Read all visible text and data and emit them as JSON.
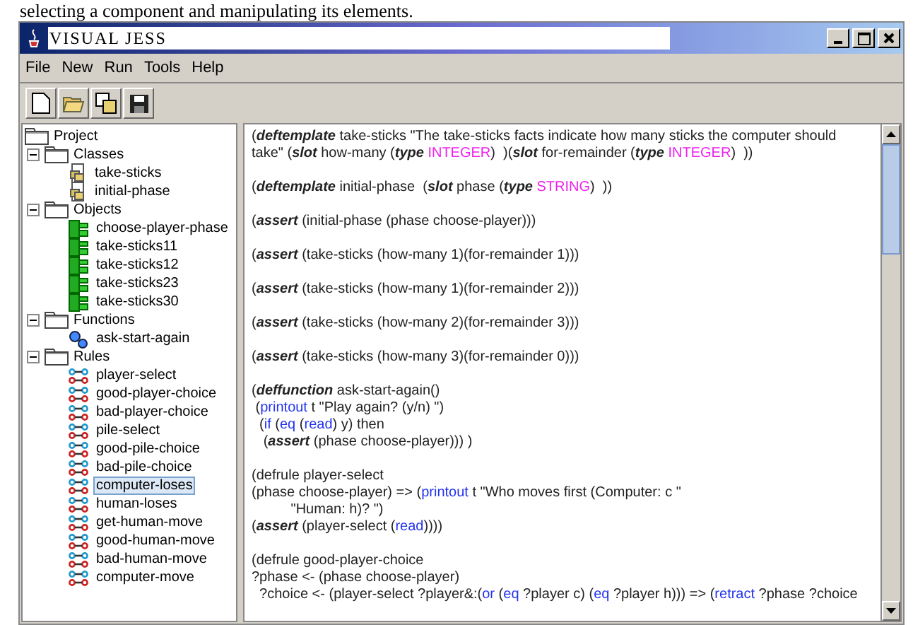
{
  "caption": "selecting a component and manipulating its elements.",
  "window": {
    "title": "VISUAL JESS"
  },
  "menu": [
    "File",
    "New",
    "Run",
    "Tools",
    "Help"
  ],
  "toolbar": [
    {
      "kind": "new"
    },
    {
      "kind": "open"
    },
    {
      "kind": "copy"
    },
    {
      "kind": "save"
    }
  ],
  "tree": {
    "label": "Project",
    "children": [
      {
        "label": "Classes",
        "expanded": true,
        "children": [
          {
            "label": "take-sticks",
            "kind": "class",
            "selected": false
          },
          {
            "label": "initial-phase",
            "kind": "class",
            "selected": false
          }
        ]
      },
      {
        "label": "Objects",
        "expanded": true,
        "children": [
          {
            "label": "choose-player-phase",
            "kind": "object",
            "selected": false
          },
          {
            "label": "take-sticks11",
            "kind": "object",
            "selected": false
          },
          {
            "label": "take-sticks12",
            "kind": "object",
            "selected": false
          },
          {
            "label": "take-sticks23",
            "kind": "object",
            "selected": false
          },
          {
            "label": "take-sticks30",
            "kind": "object",
            "selected": false
          }
        ]
      },
      {
        "label": "Functions",
        "expanded": true,
        "children": [
          {
            "label": "ask-start-again",
            "kind": "function",
            "selected": false
          }
        ]
      },
      {
        "label": "Rules",
        "expanded": true,
        "children": [
          {
            "label": "player-select",
            "kind": "rule",
            "selected": false
          },
          {
            "label": "good-player-choice",
            "kind": "rule",
            "selected": false
          },
          {
            "label": "bad-player-choice",
            "kind": "rule",
            "selected": false
          },
          {
            "label": "pile-select",
            "kind": "rule",
            "selected": false
          },
          {
            "label": "good-pile-choice",
            "kind": "rule",
            "selected": false
          },
          {
            "label": "bad-pile-choice",
            "kind": "rule",
            "selected": false
          },
          {
            "label": "computer-loses",
            "kind": "rule",
            "selected": true
          },
          {
            "label": "human-loses",
            "kind": "rule",
            "selected": false
          },
          {
            "label": "get-human-move",
            "kind": "rule",
            "selected": false
          },
          {
            "label": "good-human-move",
            "kind": "rule",
            "selected": false
          },
          {
            "label": "bad-human-move",
            "kind": "rule",
            "selected": false
          },
          {
            "label": "computer-move",
            "kind": "rule",
            "selected": false
          }
        ]
      }
    ]
  },
  "code_blocks": [
    [
      [
        {
          "kind": "text",
          "text": "("
        },
        {
          "kind": "keyword",
          "text": "deftemplate"
        },
        {
          "kind": "text",
          "text": " take-sticks \"The take-sticks facts indicate how many sticks the computer should"
        }
      ],
      [
        {
          "kind": "text",
          "text": "take\" ("
        },
        {
          "kind": "keyword",
          "text": "slot"
        },
        {
          "kind": "text",
          "text": " how-many ("
        },
        {
          "kind": "keyword",
          "text": "type"
        },
        {
          "kind": "type",
          "text": " INTEGER"
        },
        {
          "kind": "text",
          "text": ")  )("
        },
        {
          "kind": "keyword",
          "text": "slot"
        },
        {
          "kind": "text",
          "text": " for-remainder ("
        },
        {
          "kind": "keyword",
          "text": "type"
        },
        {
          "kind": "type",
          "text": " INTEGER"
        },
        {
          "kind": "text",
          "text": ")  ))"
        }
      ]
    ],
    [
      [
        {
          "kind": "text",
          "text": "("
        },
        {
          "kind": "keyword",
          "text": "deftemplate"
        },
        {
          "kind": "text",
          "text": " initial-phase  ("
        },
        {
          "kind": "keyword",
          "text": "slot"
        },
        {
          "kind": "text",
          "text": " phase ("
        },
        {
          "kind": "keyword",
          "text": "type"
        },
        {
          "kind": "type",
          "text": " STRING"
        },
        {
          "kind": "text",
          "text": ")  ))"
        }
      ]
    ],
    [
      [
        {
          "kind": "text",
          "text": "("
        },
        {
          "kind": "keyword",
          "text": "assert"
        },
        {
          "kind": "text",
          "text": " (initial-phase (phase choose-player)))"
        }
      ]
    ],
    [
      [
        {
          "kind": "text",
          "text": "("
        },
        {
          "kind": "keyword",
          "text": "assert"
        },
        {
          "kind": "text",
          "text": " (take-sticks (how-many 1)(for-remainder 1)))"
        }
      ]
    ],
    [
      [
        {
          "kind": "text",
          "text": "("
        },
        {
          "kind": "keyword",
          "text": "assert"
        },
        {
          "kind": "text",
          "text": " (take-sticks (how-many 1)(for-remainder 2)))"
        }
      ]
    ],
    [
      [
        {
          "kind": "text",
          "text": "("
        },
        {
          "kind": "keyword",
          "text": "assert"
        },
        {
          "kind": "text",
          "text": " (take-sticks (how-many 2)(for-remainder 3)))"
        }
      ]
    ],
    [
      [
        {
          "kind": "text",
          "text": "("
        },
        {
          "kind": "keyword",
          "text": "assert"
        },
        {
          "kind": "text",
          "text": " (take-sticks (how-many 3)(for-remainder 0)))"
        }
      ]
    ],
    [
      [
        {
          "kind": "text",
          "text": "("
        },
        {
          "kind": "keyword",
          "text": "deffunction"
        },
        {
          "kind": "text",
          "text": " ask-start-again()"
        }
      ],
      [
        {
          "kind": "text",
          "text": " ("
        },
        {
          "kind": "function",
          "text": "printout"
        },
        {
          "kind": "text",
          "text": " t \"Play again? (y/n) \")"
        }
      ],
      [
        {
          "kind": "text",
          "text": "  ("
        },
        {
          "kind": "function",
          "text": "if"
        },
        {
          "kind": "text",
          "text": " ("
        },
        {
          "kind": "function",
          "text": "eq"
        },
        {
          "kind": "text",
          "text": " ("
        },
        {
          "kind": "function",
          "text": "read"
        },
        {
          "kind": "text",
          "text": ") y) then"
        }
      ],
      [
        {
          "kind": "text",
          "text": "   ("
        },
        {
          "kind": "keyword",
          "text": "assert"
        },
        {
          "kind": "text",
          "text": " (phase choose-player))) )"
        }
      ]
    ],
    [
      [
        {
          "kind": "text",
          "text": "(defrule player-select"
        }
      ],
      [
        {
          "kind": "text",
          "text": "(phase choose-player) => ("
        },
        {
          "kind": "function",
          "text": "printout"
        },
        {
          "kind": "text",
          "text": " t \"Who moves first (Computer: c \""
        }
      ],
      [
        {
          "kind": "text",
          "text": "          \"Human: h)? \")"
        }
      ],
      [
        {
          "kind": "text",
          "text": "("
        },
        {
          "kind": "keyword",
          "text": "assert"
        },
        {
          "kind": "text",
          "text": " (player-select ("
        },
        {
          "kind": "function",
          "text": "read"
        },
        {
          "kind": "text",
          "text": "))))"
        }
      ]
    ],
    [
      [
        {
          "kind": "text",
          "text": "(defrule good-player-choice"
        }
      ],
      [
        {
          "kind": "text",
          "text": "?phase <- (phase choose-player)"
        }
      ],
      [
        {
          "kind": "text",
          "text": "  ?choice <- (player-select ?player&:("
        },
        {
          "kind": "function",
          "text": "or"
        },
        {
          "kind": "text",
          "text": " ("
        },
        {
          "kind": "function",
          "text": "eq"
        },
        {
          "kind": "text",
          "text": " ?player c) ("
        },
        {
          "kind": "function",
          "text": "eq"
        },
        {
          "kind": "text",
          "text": " ?player h))) => ("
        },
        {
          "kind": "function",
          "text": "retract"
        },
        {
          "kind": "text",
          "text": " ?phase ?choice"
        }
      ]
    ]
  ]
}
